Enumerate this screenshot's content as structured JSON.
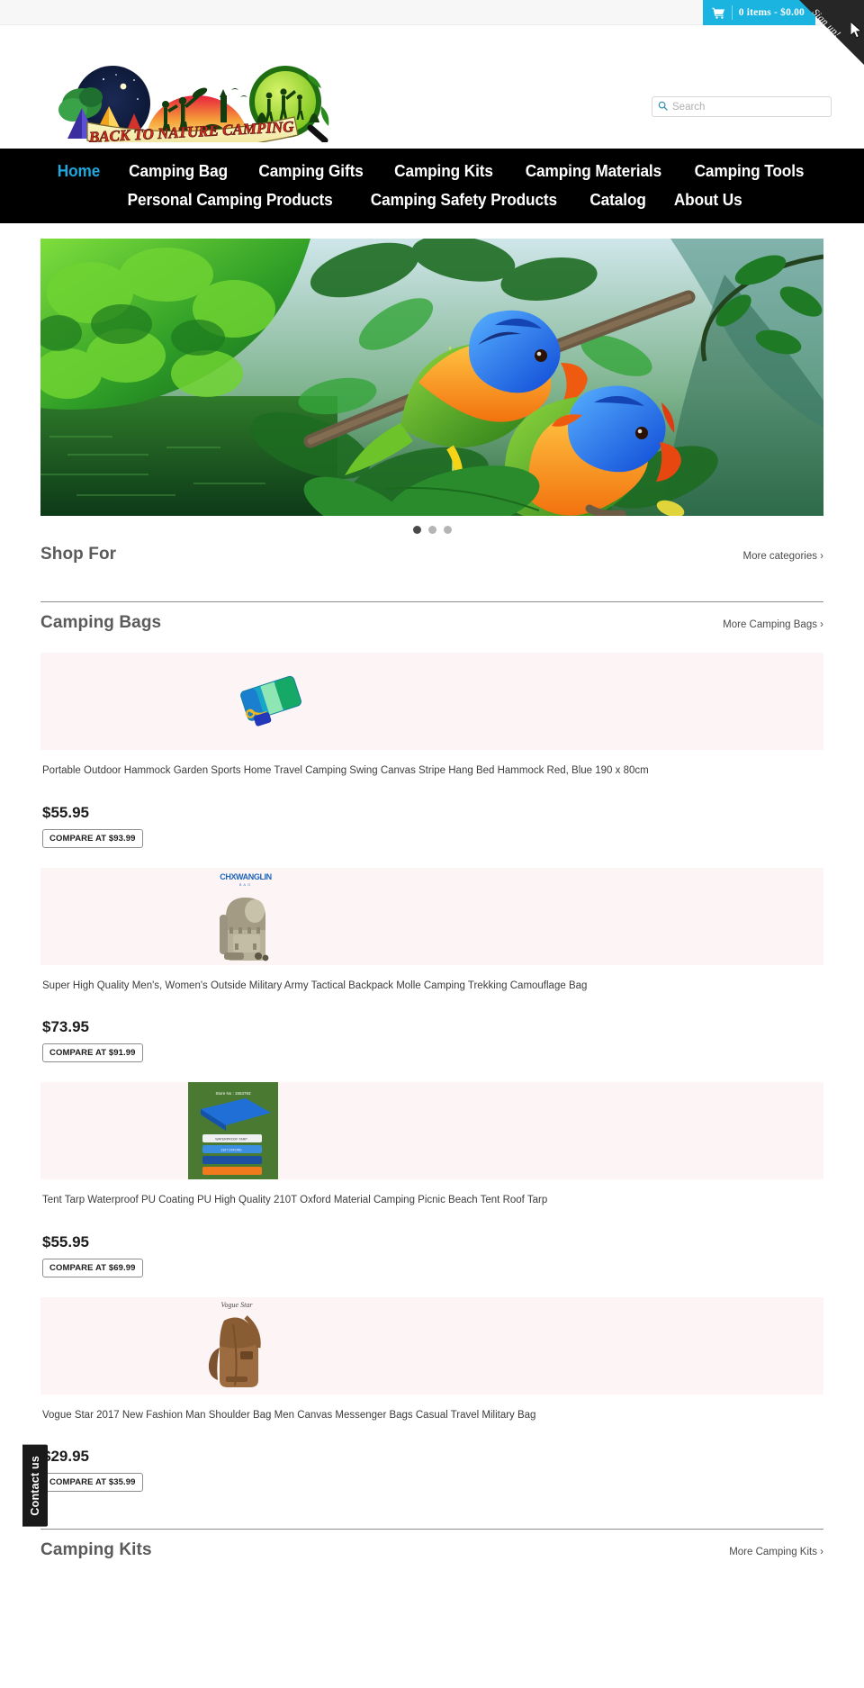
{
  "topbar": {
    "cart_label": "0 items - $0.00",
    "cart_icon": "shopping-cart-icon",
    "ribbon_label": "Sign up!"
  },
  "header": {
    "logo_text": "BACK TO NATURE CAMPING",
    "logo_alt": "Back To Nature Camping logo",
    "search": {
      "placeholder": "Search",
      "value": "",
      "icon": "search-icon"
    }
  },
  "nav": {
    "row1": [
      {
        "label": "Home",
        "active": true
      },
      {
        "label": "Camping Bag",
        "active": false
      },
      {
        "label": "Camping Gifts",
        "active": false
      },
      {
        "label": "Camping Kits",
        "active": false
      },
      {
        "label": "Camping Materials",
        "active": false
      },
      {
        "label": "Camping Tools",
        "active": false
      }
    ],
    "row2": [
      {
        "label": "Personal Camping Products",
        "active": false
      },
      {
        "label": "Camping Safety Products",
        "active": false
      },
      {
        "label": "Catalog",
        "active": false
      },
      {
        "label": "About Us",
        "active": false
      }
    ]
  },
  "hero": {
    "alt": "Two rainbow lorikeet parrots perched on a branch in a green rainforest",
    "slides": 3,
    "active_slide": 1
  },
  "sections": [
    {
      "id": "shop-for",
      "title": "Shop For",
      "more_label": "More categories ›",
      "products": []
    },
    {
      "id": "camping-bags",
      "title": "Camping Bags",
      "more_label": "More Camping Bags ›",
      "products": [
        {
          "title": "Portable Outdoor Hammock Garden Sports Home Travel Camping Swing Canvas Stripe Hang Bed Hammock Red, Blue 190 x 80cm",
          "price": "$55.95",
          "compare": "COMPARE AT $93.99",
          "image": "hammock-teal-blue-folded"
        },
        {
          "title": "Super High Quality Men's, Women's Outside Military Army Tactical Backpack Molle Camping Trekking Camouflage Bag",
          "price": "$73.95",
          "compare": "COMPARE AT $91.99",
          "image": "camouflage-tactical-backpack"
        },
        {
          "title": "Tent Tarp Waterproof PU Coating PU High Quality 210T Oxford Material Camping Picnic Beach Tent Roof Tarp",
          "price": "$55.95",
          "compare": "COMPARE AT $69.99",
          "image": "blue-tent-tarp-stack"
        },
        {
          "title": "Vogue Star 2017 New Fashion Man Shoulder Bag Men Canvas Messenger Bags Casual Travel Military Bag",
          "price": "$29.95",
          "compare": "COMPARE AT $35.99",
          "image": "brown-canvas-sling-bag"
        }
      ]
    },
    {
      "id": "camping-kits",
      "title": "Camping Kits",
      "more_label": "More Camping Kits ›",
      "products": []
    }
  ],
  "contact_tab": {
    "label": "Contact us"
  },
  "colors": {
    "accent": "#1bb4e0",
    "nav_bg": "#000000",
    "nav_active": "#1fa8dd",
    "topbar_bg": "#f7f7f7",
    "ribbon_bg": "#262626",
    "product_pane": "#fdf5f5",
    "section_title": "#5a5a5a"
  }
}
